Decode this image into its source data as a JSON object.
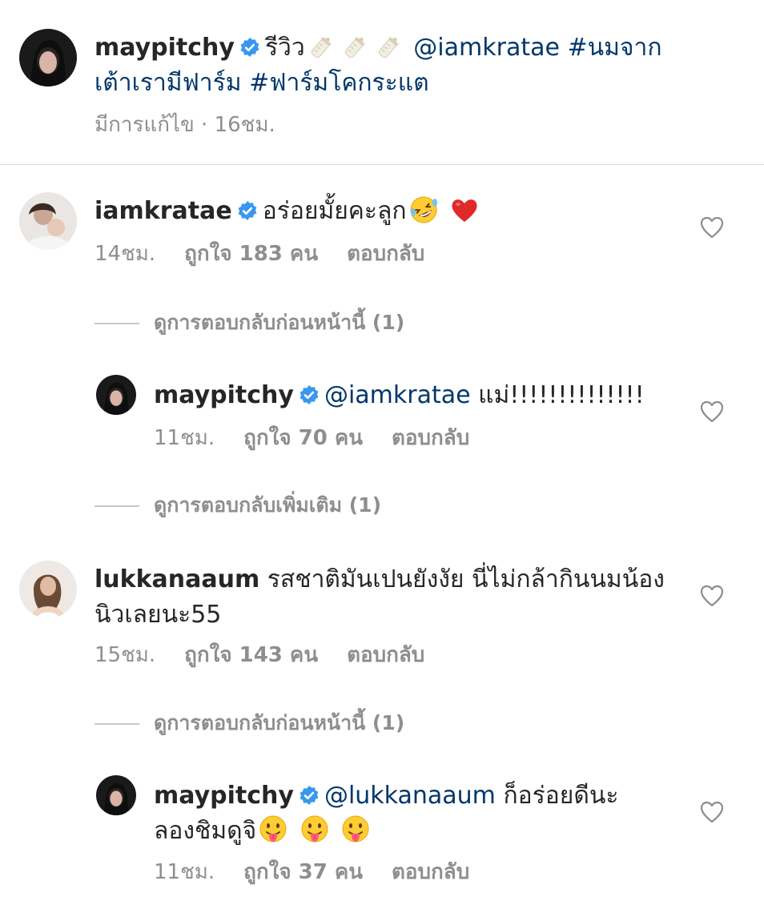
{
  "caption": {
    "username": "maypitchy",
    "line1_text": "รีวิว",
    "mention": "@iamkratae",
    "hashtag1_line1": "#นมจาก",
    "hashtag1_line2": "เต้าเรามีฟาร์ม",
    "hashtag2": "#ฟาร์มโคกระแต",
    "meta": "มีการแก้ไข · 16ชม."
  },
  "comments": [
    {
      "username": "iamkratae",
      "text": "อร่อยมั้ยคะลูก",
      "time": "14ชม.",
      "likes": "ถูกใจ 183 คน",
      "reply": "ตอบกลับ",
      "view_replies": "ดูการตอบกลับก่อนหน้านี้ (1)",
      "reply_item": {
        "username": "maypitchy",
        "mention": "@iamkratae",
        "text": "แม่!!!!!!!!!!!!!!",
        "time": "11ชม.",
        "likes": "ถูกใจ 70 คน",
        "reply": "ตอบกลับ"
      },
      "view_more": "ดูการตอบกลับเพิ่มเติม (1)"
    },
    {
      "username": "lukkanaaum",
      "text_line1": "รสชาติมันเปนยังงัย นี่ไม่กล้ากินนมน้อง",
      "text_line2": "นิวเลยนะ55",
      "time": "15ชม.",
      "likes": "ถูกใจ 143 คน",
      "reply": "ตอบกลับ",
      "view_replies": "ดูการตอบกลับก่อนหน้านี้ (1)",
      "reply_item": {
        "username": "maypitchy",
        "mention": "@lukkanaaum",
        "text_line1": "ก็อร่อยดีนะ",
        "text_line2": "ลองชิมดูจิ",
        "time": "11ชม.",
        "likes": "ถูกใจ 37 คน",
        "reply": "ตอบกลับ"
      }
    }
  ],
  "icons": {
    "verified": "verified-badge-icon",
    "heart": "heart-outline-icon",
    "bottle": "baby-bottle-emoji",
    "laugh": "rolling-laughing-emoji",
    "red_heart": "red-heart-emoji",
    "tongue": "tongue-out-emoji"
  },
  "colors": {
    "link": "#00376b",
    "verified": "#3897f0",
    "meta": "#8e8e8e"
  }
}
